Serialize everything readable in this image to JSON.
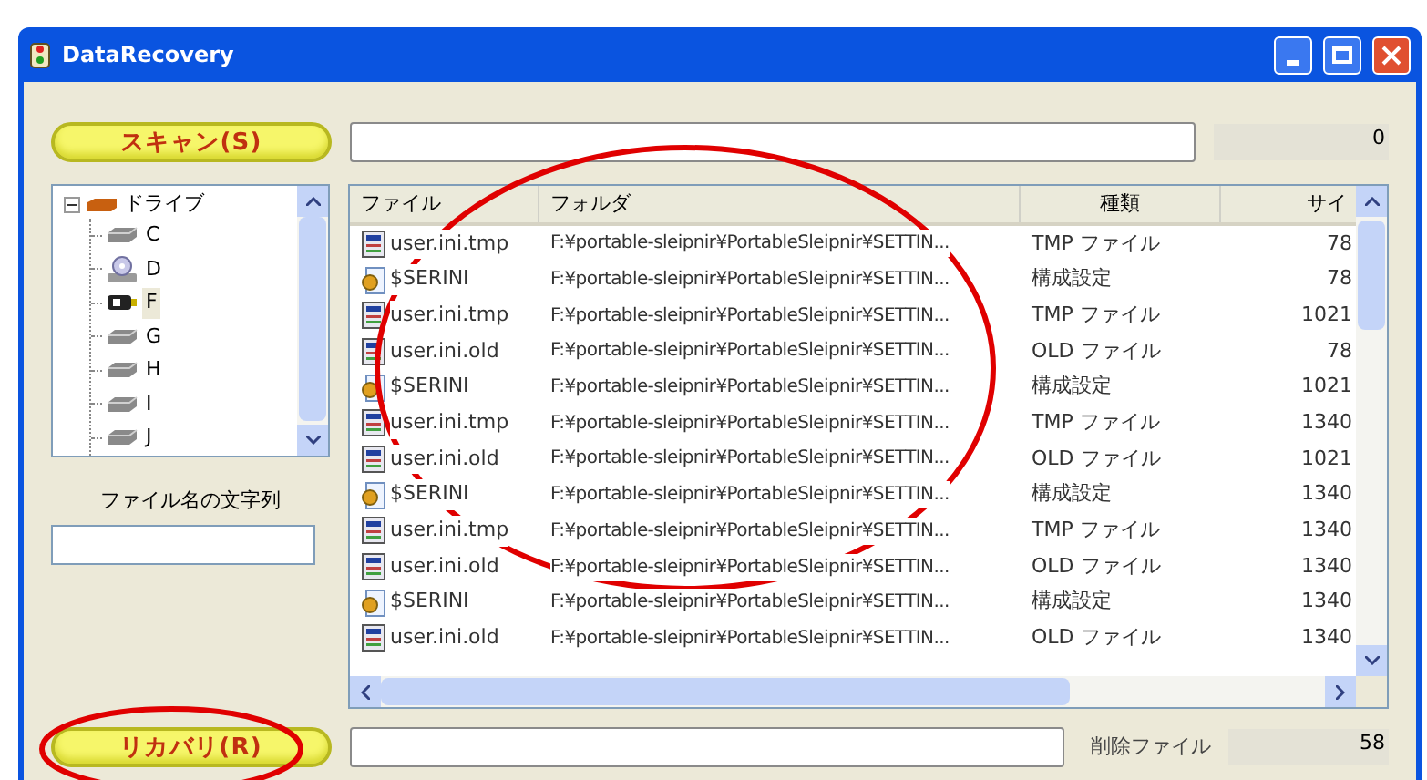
{
  "window": {
    "title": "DataRecovery"
  },
  "scan": {
    "button": "スキャン(S)",
    "count": "0"
  },
  "tree": {
    "label": "ドライブ",
    "expanded": true,
    "children": [
      {
        "label": "C",
        "kind": "hdd",
        "selected": false
      },
      {
        "label": "D",
        "kind": "cd",
        "selected": false
      },
      {
        "label": "F",
        "kind": "usb",
        "selected": true
      },
      {
        "label": "G",
        "kind": "hdd",
        "selected": false
      },
      {
        "label": "H",
        "kind": "hdd",
        "selected": false
      },
      {
        "label": "I",
        "kind": "hdd",
        "selected": false
      },
      {
        "label": "J",
        "kind": "hdd",
        "selected": false
      }
    ]
  },
  "filter": {
    "label": "ファイル名の文字列"
  },
  "table": {
    "columns": [
      "ファイル",
      "フォルダ",
      "種類",
      "サイ"
    ],
    "rows": [
      {
        "kind": "file",
        "cells": [
          "user.ini.tmp",
          "F:¥portable-sleipnir¥PortableSleipnir¥SETTIN...",
          "TMP ファイル",
          "78"
        ]
      },
      {
        "kind": "settings",
        "cells": [
          "$SERINI",
          "F:¥portable-sleipnir¥PortableSleipnir¥SETTIN...",
          "構成設定",
          "78"
        ]
      },
      {
        "kind": "file",
        "cells": [
          "user.ini.tmp",
          "F:¥portable-sleipnir¥PortableSleipnir¥SETTIN...",
          "TMP ファイル",
          "1021"
        ]
      },
      {
        "kind": "file",
        "cells": [
          "user.ini.old",
          "F:¥portable-sleipnir¥PortableSleipnir¥SETTIN...",
          "OLD ファイル",
          "78"
        ]
      },
      {
        "kind": "settings",
        "cells": [
          "$SERINI",
          "F:¥portable-sleipnir¥PortableSleipnir¥SETTIN...",
          "構成設定",
          "1021"
        ]
      },
      {
        "kind": "file",
        "cells": [
          "user.ini.tmp",
          "F:¥portable-sleipnir¥PortableSleipnir¥SETTIN...",
          "TMP ファイル",
          "1340"
        ]
      },
      {
        "kind": "file",
        "cells": [
          "user.ini.old",
          "F:¥portable-sleipnir¥PortableSleipnir¥SETTIN...",
          "OLD ファイル",
          "1021"
        ]
      },
      {
        "kind": "settings",
        "cells": [
          "$SERINI",
          "F:¥portable-sleipnir¥PortableSleipnir¥SETTIN...",
          "構成設定",
          "1340"
        ]
      },
      {
        "kind": "file",
        "cells": [
          "user.ini.tmp",
          "F:¥portable-sleipnir¥PortableSleipnir¥SETTIN...",
          "TMP ファイル",
          "1340"
        ]
      },
      {
        "kind": "file",
        "cells": [
          "user.ini.old",
          "F:¥portable-sleipnir¥PortableSleipnir¥SETTIN...",
          "OLD ファイル",
          "1340"
        ]
      },
      {
        "kind": "settings",
        "cells": [
          "$SERINI",
          "F:¥portable-sleipnir¥PortableSleipnir¥SETTIN...",
          "構成設定",
          "1340"
        ]
      },
      {
        "kind": "file",
        "cells": [
          "user.ini.old",
          "F:¥portable-sleipnir¥PortableSleipnir¥SETTIN...",
          "OLD ファイル",
          "1340"
        ]
      }
    ]
  },
  "recover": {
    "button": "リカバリ(R)",
    "deleted_label": "削除ファイル",
    "deleted_count": "58"
  }
}
